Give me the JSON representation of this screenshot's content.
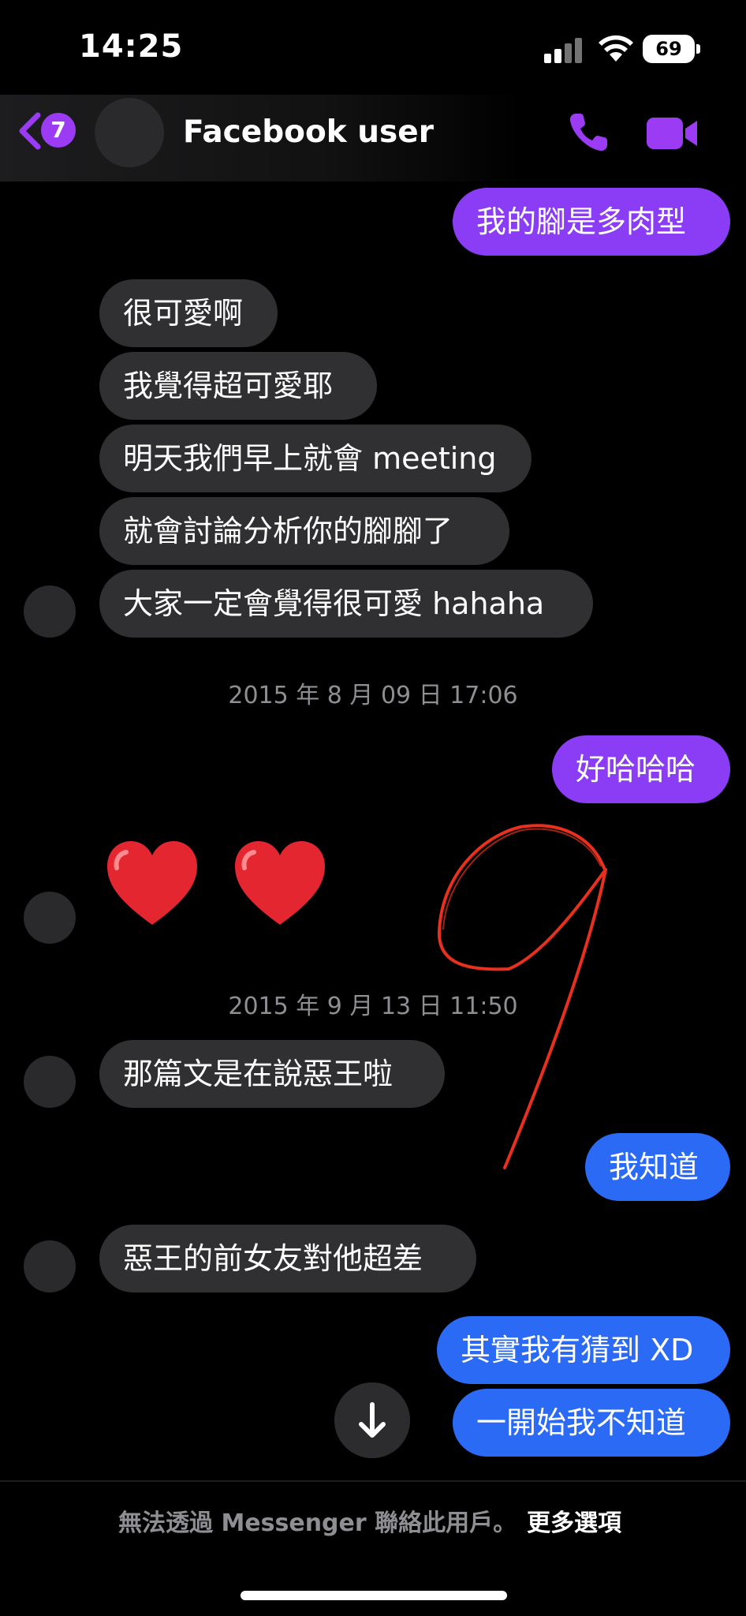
{
  "status_bar": {
    "time": "14:25",
    "battery": "69"
  },
  "header": {
    "back_badge_count": "7",
    "contact_name": "Facebook user"
  },
  "messages": {
    "m1": "我的腳是多肉型",
    "m2": "很可愛啊",
    "m3": "我覺得超可愛耶",
    "m4": "明天我們早上就會 meeting",
    "m5": "就會討論分析你的腳腳了",
    "m6": "大家一定會覺得很可愛 hahaha",
    "ts1": "2015 年 8 月 09 日 17:06",
    "m7": "好哈哈哈",
    "ts2": "2015 年 9 月 13 日 11:50",
    "m8": "那篇文是在說惡王啦",
    "m9": "我知道",
    "m10": "惡王的前女友對他超差",
    "m11": "其實我有猜到 XD",
    "m12": "一開始我不知道"
  },
  "footer": {
    "note": "無法透過 Messenger 聯絡此用戶。",
    "more_options": "更多選項"
  },
  "colors": {
    "outgoing_purple": "#8b3cf5",
    "outgoing_blue": "#2a6af5",
    "incoming": "#303033",
    "accent": "#9b3cf4",
    "annotation": "#e8301f"
  },
  "icons": [
    "back-chevron-icon",
    "phone-icon",
    "video-camera-icon",
    "arrow-down-icon",
    "heart-emoji",
    "cellular-signal-icon",
    "wifi-icon",
    "battery-icon"
  ]
}
